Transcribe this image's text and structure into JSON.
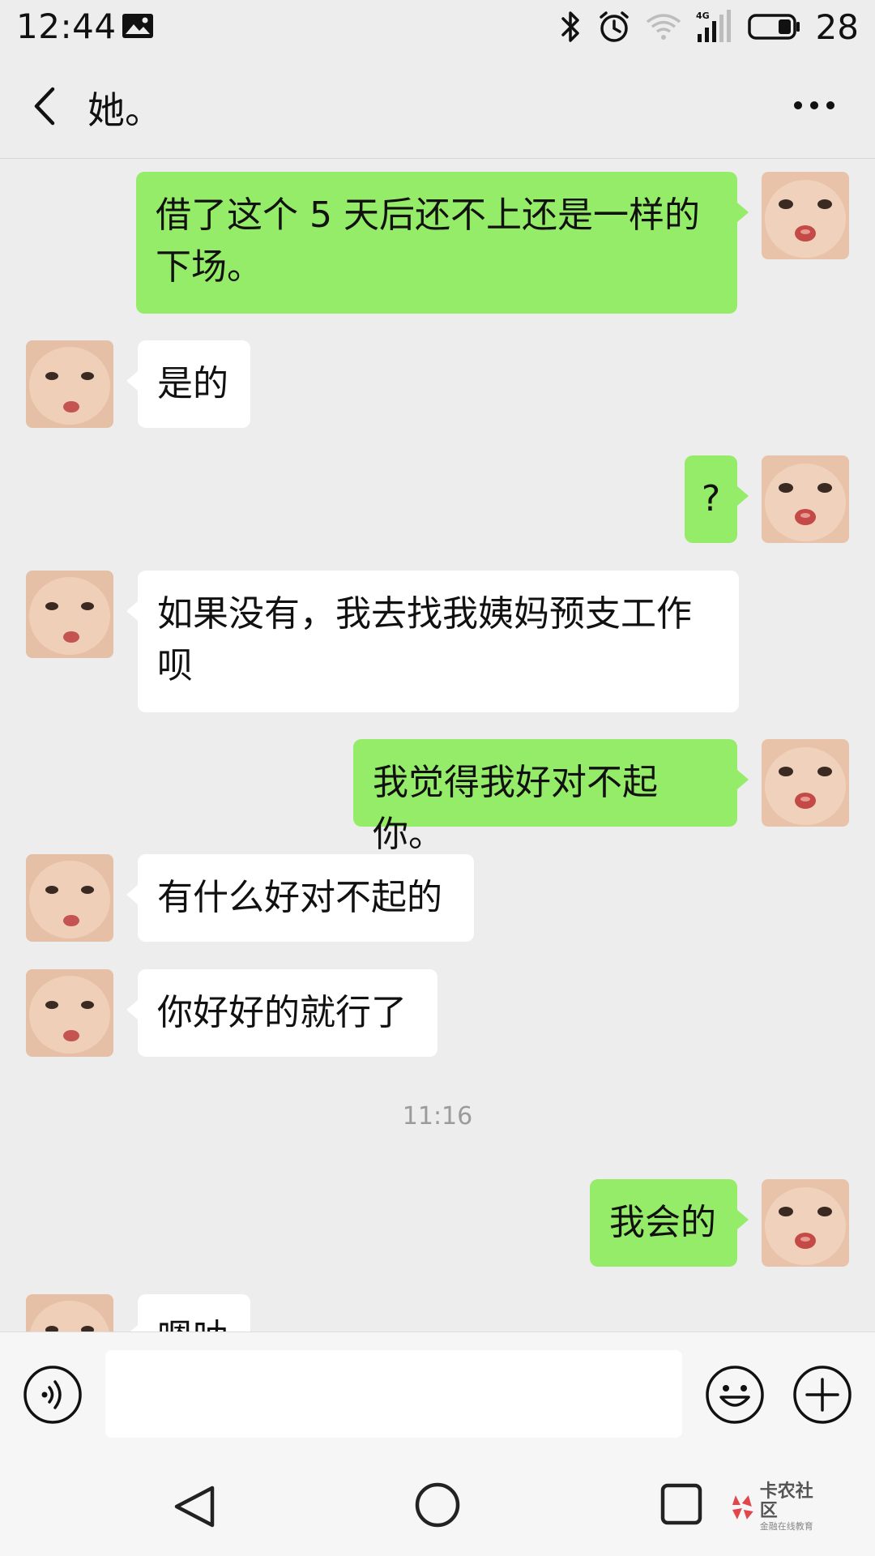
{
  "status_bar": {
    "time": "12:44",
    "network": "4G",
    "battery": "28",
    "icons": [
      "gallery-icon",
      "bluetooth-icon",
      "alarm-icon",
      "wifi-icon",
      "signal-icon",
      "battery-icon"
    ]
  },
  "header": {
    "title": "她。",
    "back_icon": "back-chevron-icon",
    "more_icon": "more-icon"
  },
  "messages": [
    {
      "direction": "out",
      "lines": [
        "借了这个 5 天后还不上还是一样的",
        "下场。"
      ]
    },
    {
      "direction": "in",
      "lines": [
        "是的"
      ]
    },
    {
      "direction": "out",
      "lines": [
        "?"
      ]
    },
    {
      "direction": "in",
      "lines": [
        "如果没有，我去找我姨妈预支工作",
        "呗"
      ]
    },
    {
      "direction": "out",
      "lines": [
        "我觉得我好对不起你。"
      ]
    },
    {
      "direction": "in",
      "lines": [
        "有什么好对不起的"
      ]
    },
    {
      "direction": "in",
      "lines": [
        "你好好的就行了"
      ]
    },
    {
      "type": "timestamp",
      "text": "11:16"
    },
    {
      "direction": "out",
      "lines": [
        "我会的"
      ]
    },
    {
      "direction": "in",
      "lines": [
        "嗯呐"
      ]
    }
  ],
  "input_bar": {
    "text": "",
    "voice_icon": "voice-icon",
    "emoji_icon": "emoji-icon",
    "plus_icon": "plus-icon"
  },
  "nav_bar": {
    "icons": [
      "nav-back-icon",
      "nav-home-icon",
      "nav-recent-icon"
    ],
    "watermark": {
      "main": "卡农社区",
      "sub": "金融在线教育"
    }
  },
  "colors": {
    "background": "#ededed",
    "outgoing_bubble": "#95ec69",
    "incoming_bubble": "#ffffff",
    "timestamp": "#9b9b9b"
  }
}
